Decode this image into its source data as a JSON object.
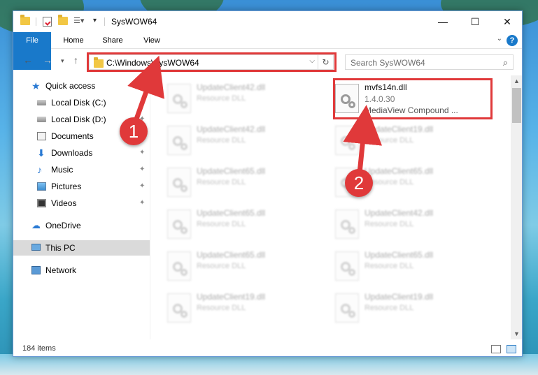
{
  "window": {
    "title": "SysWOW64"
  },
  "ribbon": {
    "tabs": [
      "File",
      "Home",
      "Share",
      "View"
    ],
    "help": "?"
  },
  "address": {
    "path": "C:\\Windows\\SysWOW64",
    "search_placeholder": "Search SysWOW64"
  },
  "sidebar": {
    "items": [
      {
        "label": "Quick access",
        "icon": "star-icon"
      },
      {
        "label": "Local Disk (C:)",
        "icon": "disk-icon"
      },
      {
        "label": "Local Disk (D:)",
        "icon": "disk-icon"
      },
      {
        "label": "Documents",
        "icon": "document-icon"
      },
      {
        "label": "Downloads",
        "icon": "download-icon"
      },
      {
        "label": "Music",
        "icon": "music-icon"
      },
      {
        "label": "Pictures",
        "icon": "pictures-icon"
      },
      {
        "label": "Videos",
        "icon": "video-icon"
      },
      {
        "label": "OneDrive",
        "icon": "cloud-icon"
      },
      {
        "label": "This PC",
        "icon": "computer-icon"
      },
      {
        "label": "Network",
        "icon": "network-icon"
      }
    ]
  },
  "files": [
    {
      "name": "UpdateClient42.dll",
      "type": "Resource DLL"
    },
    {
      "name": "mvfs14n.dll",
      "version": "1.4.0.30",
      "description": "MediaView Compound ..."
    },
    {
      "name": "UpdateClient42.dll",
      "type": "Resource DLL"
    },
    {
      "name": "UpdateClient19.dll",
      "type": "Resource DLL"
    },
    {
      "name": "UpdateClient65.dll",
      "type": "Resource DLL"
    },
    {
      "name": "UpdateClient65.dll",
      "type": "Resource DLL"
    },
    {
      "name": "UpdateClient65.dll",
      "type": "Resource DLL"
    },
    {
      "name": "UpdateClient42.dll",
      "type": "Resource DLL"
    },
    {
      "name": "UpdateClient65.dll",
      "type": "Resource DLL"
    },
    {
      "name": "UpdateClient65.dll",
      "type": "Resource DLL"
    },
    {
      "name": "UpdateClient19.dll",
      "type": "Resource DLL"
    },
    {
      "name": "UpdateClient19.dll",
      "type": "Resource DLL"
    }
  ],
  "status": {
    "item_count": "184 items"
  },
  "annotations": {
    "marker1": "1",
    "marker2": "2",
    "highlight_color": "#e0393a"
  },
  "colors": {
    "accent": "#1979ca",
    "highlight": "#e0393a"
  }
}
